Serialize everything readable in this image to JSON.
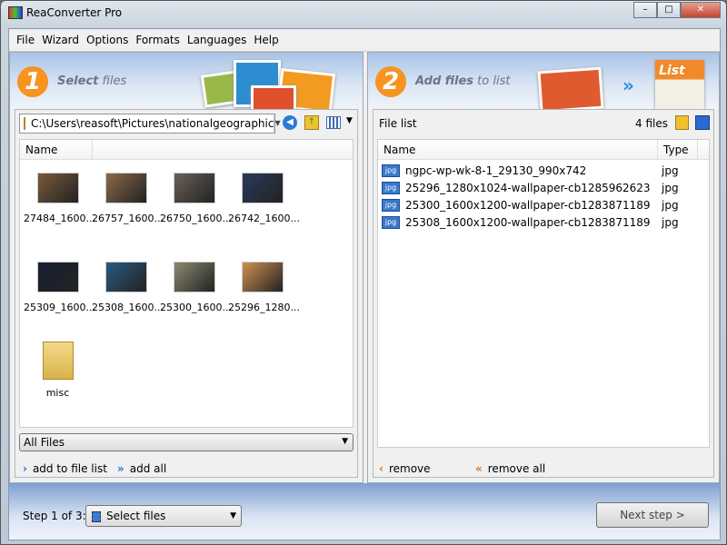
{
  "window": {
    "title": "ReaConverter Pro",
    "controls": [
      "minimize",
      "maximize",
      "close"
    ]
  },
  "menu": [
    "File",
    "Wizard",
    "Options",
    "Formats",
    "Languages",
    "Help"
  ],
  "step1": {
    "number": "1",
    "title_bold": "Select",
    "title_rest": " files",
    "path": "C:\\Users\\reasoft\\Pictures\\nationalgeographic",
    "column": "Name",
    "items": [
      {
        "label": "27484_1600...",
        "color": "#7a5a3a"
      },
      {
        "label": "26757_1600...",
        "color": "#8a6a4a"
      },
      {
        "label": "26750_1600...",
        "color": "#6a6058"
      },
      {
        "label": "26742_1600...",
        "color": "#2a3a5a"
      },
      {
        "label": "25309_1600...",
        "color": "#1a2035"
      },
      {
        "label": "25308_1600...",
        "color": "#2a5a80"
      },
      {
        "label": "25300_1600...",
        "color": "#8a8a70"
      },
      {
        "label": "25296_1280...",
        "color": "#d09050"
      },
      {
        "label": "misc",
        "color": "folder"
      }
    ],
    "filter": "All Files",
    "add_to_list": "add to file list",
    "add_all": "add all"
  },
  "step2": {
    "number": "2",
    "title_bold": "Add files",
    "title_rest": " to list",
    "list_art": "List",
    "file_list_label": "File list",
    "count": "4 files",
    "columns": [
      "Name",
      "Type"
    ],
    "files": [
      {
        "name": "ngpc-wp-wk-8-1_29130_990x742",
        "type": "jpg"
      },
      {
        "name": "25296_1280x1024-wallpaper-cb1285962623",
        "type": "jpg"
      },
      {
        "name": "25300_1600x1200-wallpaper-cb1283871189",
        "type": "jpg"
      },
      {
        "name": "25308_1600x1200-wallpaper-cb1283871189",
        "type": "jpg"
      }
    ],
    "file_icon_label": "jpg",
    "remove": "remove",
    "remove_all": "remove all"
  },
  "footer": {
    "step_label": "Step 1 of 3:",
    "step_value": "Select files",
    "next": "Next step >"
  }
}
